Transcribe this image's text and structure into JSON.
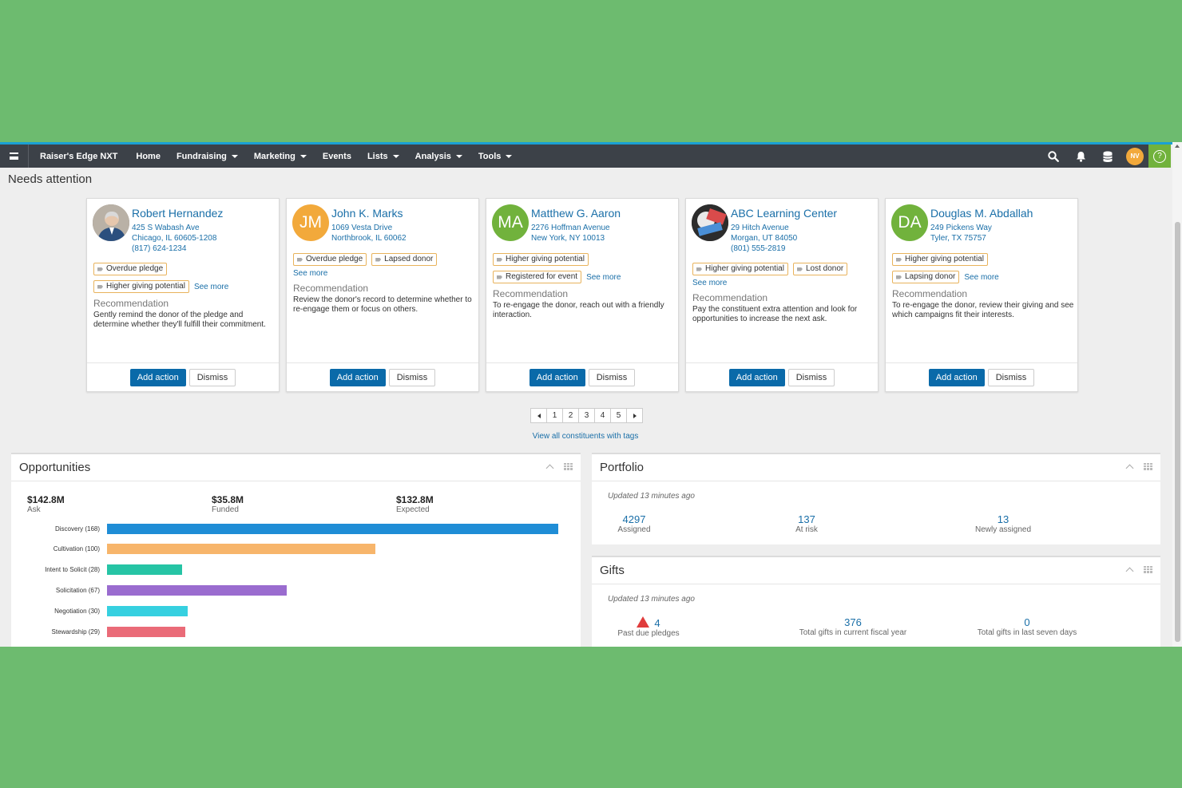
{
  "app": {
    "brand": "Raiser's Edge NXT",
    "user_initials": "NV",
    "help_glyph": "?"
  },
  "nav": [
    {
      "label": "Home",
      "dropdown": false
    },
    {
      "label": "Fundraising",
      "dropdown": true
    },
    {
      "label": "Marketing",
      "dropdown": true
    },
    {
      "label": "Events",
      "dropdown": false
    },
    {
      "label": "Lists",
      "dropdown": true
    },
    {
      "label": "Analysis",
      "dropdown": true
    },
    {
      "label": "Tools",
      "dropdown": true
    }
  ],
  "needs_attention": {
    "title": "Needs attention",
    "add_action_label": "Add action",
    "dismiss_label": "Dismiss",
    "rec_label": "Recommendation",
    "see_more_label": "See more",
    "cards": [
      {
        "name": "Robert Hernandez",
        "avatar": "photo",
        "avatar_color": "#8a7a6a",
        "initials": "",
        "address": [
          "425 S Wabash Ave",
          "Chicago, IL 60605-1208",
          "(817) 624-1234"
        ],
        "tag_rows": [
          [
            "Overdue pledge"
          ],
          [
            "Higher giving potential"
          ]
        ],
        "see_more_inline": true,
        "recommendation": "Gently remind the donor of the pledge and determine whether they'll fulfill their commitment."
      },
      {
        "name": "John K. Marks",
        "avatar": "initials",
        "avatar_color": "#f2a93b",
        "initials": "JM",
        "address": [
          "1069 Vesta Drive",
          "Northbrook, IL 60062"
        ],
        "tag_rows": [
          [
            "Overdue pledge",
            "Lapsed donor"
          ]
        ],
        "see_more_inline": false,
        "recommendation": "Review the donor's record to determine whether to re-engage them or focus on others."
      },
      {
        "name": "Matthew G. Aaron",
        "avatar": "initials",
        "avatar_color": "#71b23c",
        "initials": "MA",
        "address": [
          "2276 Hoffman Avenue",
          "New York, NY 10013"
        ],
        "tag_rows": [
          [
            "Higher giving potential"
          ],
          [
            "Registered for event"
          ]
        ],
        "see_more_inline": true,
        "recommendation": "To re-engage the donor, reach out with a friendly interaction."
      },
      {
        "name": "ABC Learning Center",
        "avatar": "logo",
        "avatar_color": "#3a3a3a",
        "initials": "",
        "address": [
          "29 Hitch Avenue",
          "Morgan, UT 84050",
          "(801) 555-2819"
        ],
        "tag_rows": [
          [
            "Higher giving potential",
            "Lost donor"
          ]
        ],
        "see_more_inline": false,
        "recommendation": "Pay the constituent extra attention and look for opportunities to increase the next ask."
      },
      {
        "name": "Douglas M. Abdallah",
        "avatar": "initials",
        "avatar_color": "#71b23c",
        "initials": "DA",
        "address": [
          "249 Pickens Way",
          "Tyler, TX 75757"
        ],
        "tag_rows": [
          [
            "Higher giving potential"
          ],
          [
            "Lapsing donor"
          ]
        ],
        "see_more_inline": true,
        "recommendation": "To re-engage the donor, review their giving and see which campaigns fit their interests."
      }
    ],
    "pages": [
      "1",
      "2",
      "3",
      "4",
      "5"
    ],
    "current_page": 1,
    "view_all_label": "View all constituents with tags"
  },
  "opportunities": {
    "title": "Opportunities",
    "metrics": [
      {
        "value": "$142.8M",
        "label": "Ask"
      },
      {
        "value": "$35.8M",
        "label": "Funded"
      },
      {
        "value": "$132.8M",
        "label": "Expected"
      }
    ],
    "bars": [
      {
        "label": "Discovery (168)",
        "value": 168,
        "color": "#1f8dd6"
      },
      {
        "label": "Cultivation (100)",
        "value": 100,
        "color": "#f7b56b"
      },
      {
        "label": "Intent to Solicit (28)",
        "value": 28,
        "color": "#26c4a5"
      },
      {
        "label": "Solicitation (67)",
        "value": 67,
        "color": "#9a6ccf"
      },
      {
        "label": "Negotiation (30)",
        "value": 30,
        "color": "#36d0e0"
      },
      {
        "label": "Stewardship (29)",
        "value": 29,
        "color": "#ea6b78"
      }
    ]
  },
  "portfolio": {
    "title": "Portfolio",
    "updated": "Updated 13 minutes ago",
    "stats": [
      {
        "value": "4297",
        "label": "Assigned"
      },
      {
        "value": "137",
        "label": "At risk"
      },
      {
        "value": "13",
        "label": "Newly assigned"
      }
    ]
  },
  "gifts": {
    "title": "Gifts",
    "updated": "Updated 13 minutes ago",
    "stats": [
      {
        "value": "4",
        "label": "Past due pledges",
        "warning": true
      },
      {
        "value": "376",
        "label": "Total gifts in current fiscal year"
      },
      {
        "value": "0",
        "label": "Total gifts in last seven days"
      }
    ]
  }
}
